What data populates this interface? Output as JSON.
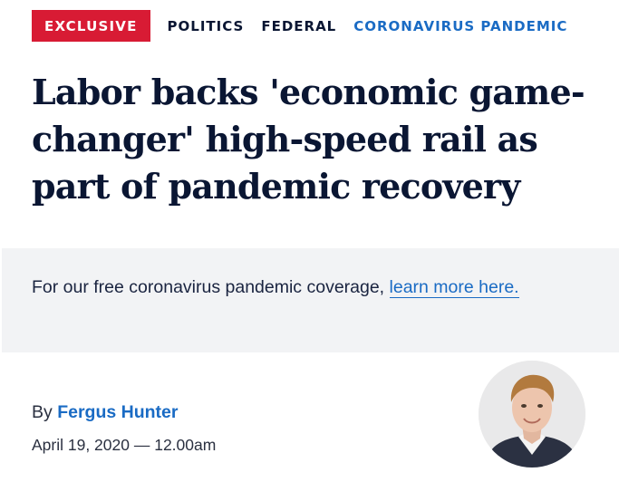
{
  "tags": {
    "badge": "EXCLUSIVE",
    "items": [
      "POLITICS",
      "FEDERAL",
      "CORONAVIRUS PANDEMIC"
    ]
  },
  "headline": "Labor backs 'economic game-changer' high-speed rail as part of pandemic recovery",
  "promo": {
    "text": "For our free coronavirus pandemic coverage, ",
    "link_label": "learn more here."
  },
  "byline": {
    "prefix": "By ",
    "author": "Fergus Hunter",
    "date": "April 19, 2020 — 12.00am"
  },
  "colors": {
    "badge_bg": "#d81b34",
    "link": "#1a6bc4",
    "headline": "#0a1633",
    "promo_bg": "#f2f3f5"
  }
}
